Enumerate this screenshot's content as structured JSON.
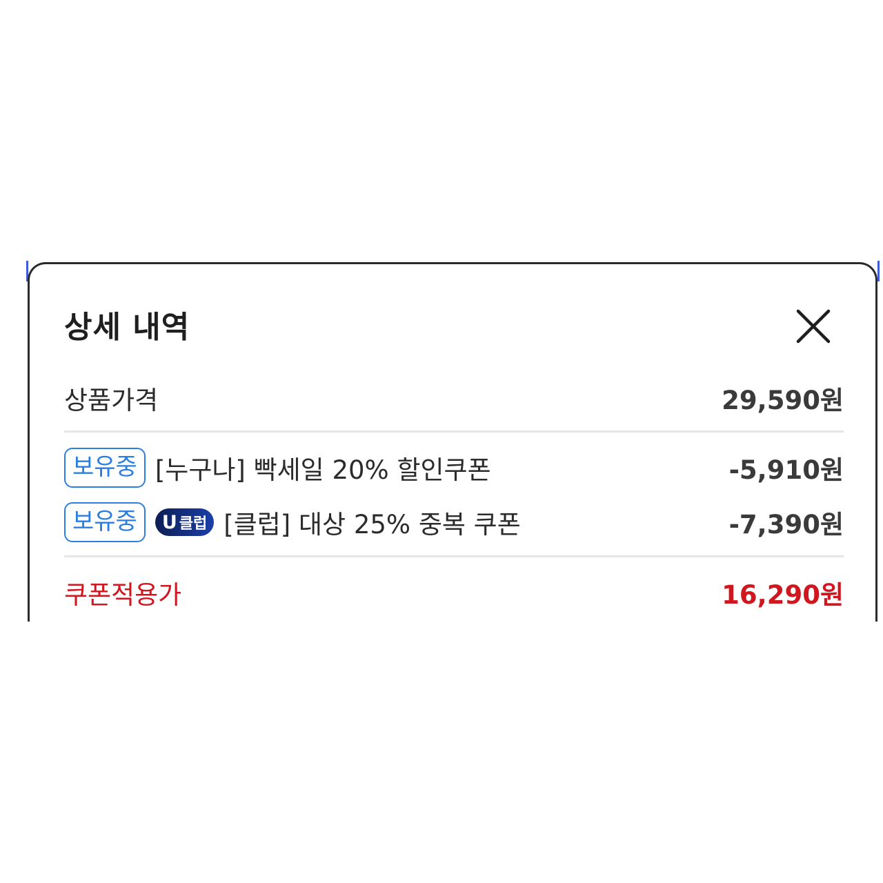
{
  "sheet": {
    "title": "상세 내역",
    "close_icon": "close-icon"
  },
  "price_row": {
    "label": "상품가격",
    "amount": "29,590원"
  },
  "coupons": [
    {
      "status_badge": "보유중",
      "club_badge": null,
      "name": "[누구나] 빡세일 20% 할인쿠폰",
      "amount": "-5,910원"
    },
    {
      "status_badge": "보유중",
      "club_badge": {
        "letter": "U",
        "text": "클럽"
      },
      "name": "[클럽] 대상 25% 중복 쿠폰",
      "amount": "-7,390원"
    }
  ],
  "total_row": {
    "label": "쿠폰적용가",
    "amount": "16,290원"
  },
  "colors": {
    "accent_blue": "#2a7de1",
    "club_navy": "#0d1e55",
    "total_red": "#d0171f"
  }
}
